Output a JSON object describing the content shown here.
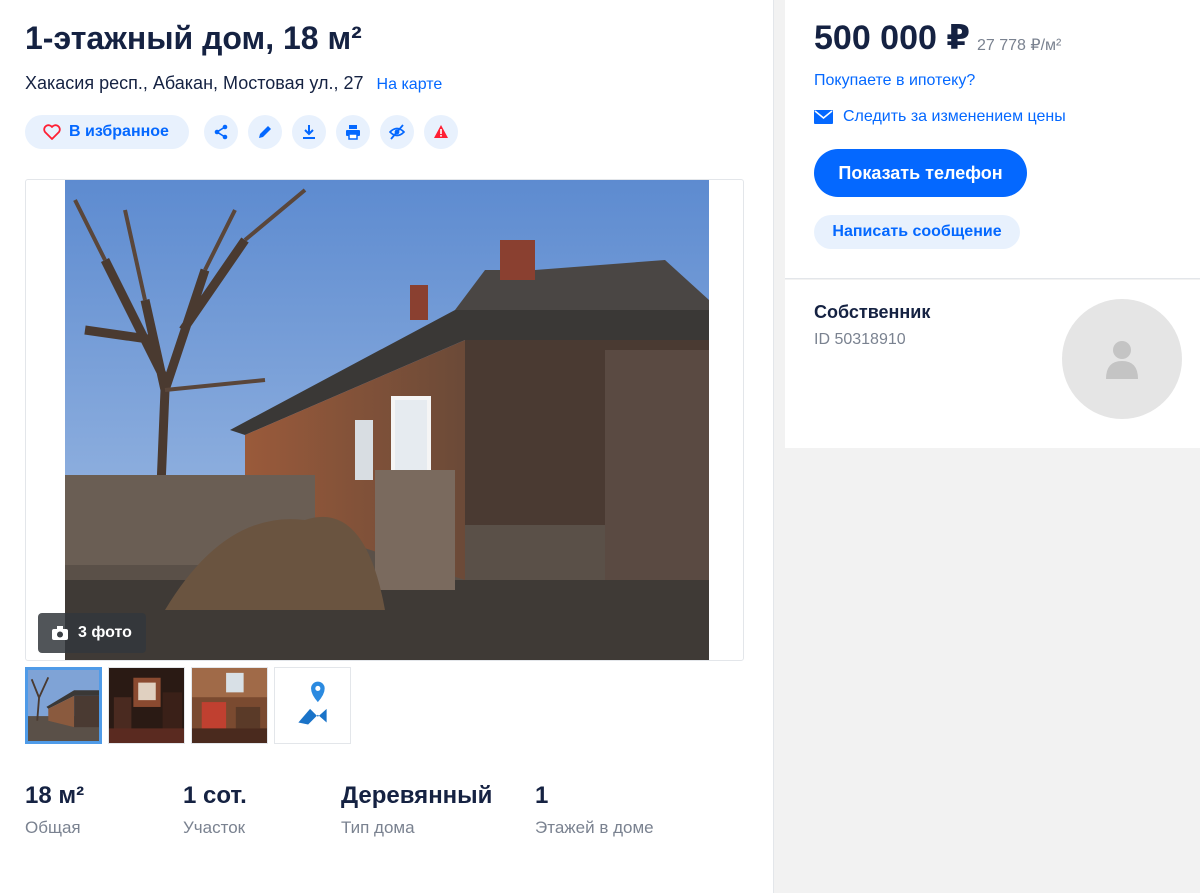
{
  "listing": {
    "title": "1-этажный дом, 18 м²",
    "address": "Хакасия респ., Абакан, Мостовая ул., 27",
    "map_link": "На карте"
  },
  "actions": {
    "favorite_label": "В избранное",
    "icons": [
      "share-icon",
      "edit-icon",
      "download-icon",
      "print-icon",
      "hide-icon",
      "report-icon"
    ]
  },
  "gallery": {
    "photo_count_label": "3 фото",
    "thumbnails": [
      "photo-1",
      "photo-2",
      "photo-3",
      "map"
    ]
  },
  "params": [
    {
      "value": "18 м²",
      "label": "Общая"
    },
    {
      "value": "1 сот.",
      "label": "Участок"
    },
    {
      "value": "Деревянный",
      "label": "Тип дома"
    },
    {
      "value": "1",
      "label": "Этажей в доме"
    }
  ],
  "price": {
    "value": "500 000 ₽",
    "per_meter": "27 778 ₽/м²",
    "mortgage_link": "Покупаете в ипотеку?",
    "watch_link": "Следить за изменением цены",
    "phone_button": "Показать телефон",
    "message_button": "Написать сообщение"
  },
  "owner": {
    "title": "Собственник",
    "id": "ID 50318910"
  },
  "colors": {
    "accent": "#0468ff",
    "accent_light": "#e8f1fd",
    "text": "#152242",
    "muted": "#7a8290",
    "report": "#ff1f34"
  }
}
